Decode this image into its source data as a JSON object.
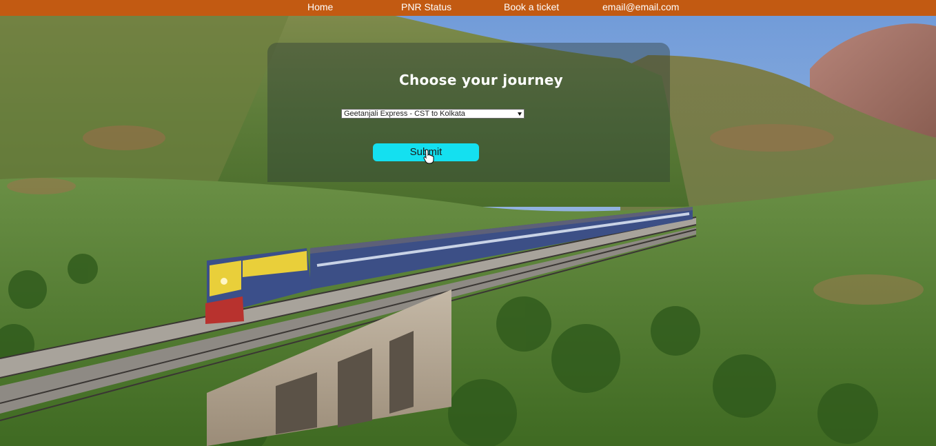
{
  "nav": {
    "home": "Home",
    "pnr_status": "PNR Status",
    "book_ticket": "Book a ticket",
    "email": "email@email.com"
  },
  "journey": {
    "title": "Choose your journey",
    "selected_option": "Geetanjali Express - CST to Kolkata",
    "submit_label": "Submit"
  },
  "colors": {
    "navbar": "#c25a12",
    "submit_button": "#14e0f0"
  },
  "background": {
    "subject": "train on bridge through green hills"
  }
}
